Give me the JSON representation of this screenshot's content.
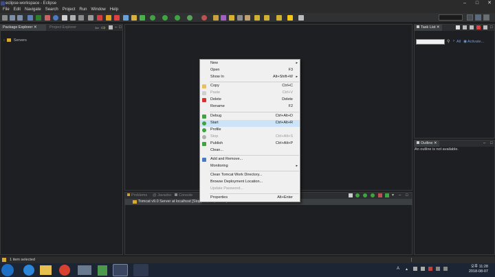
{
  "window": {
    "title": "eclipse-workspace - Eclipse"
  },
  "menubar": [
    "File",
    "Edit",
    "Navigate",
    "Search",
    "Project",
    "Run",
    "Window",
    "Help"
  ],
  "package_explorer": {
    "tabs": [
      "Package Explorer",
      "Project Explorer"
    ],
    "tree": [
      {
        "label": "Servers"
      }
    ]
  },
  "task_list": {
    "tab": "Task List",
    "filter_all": "All",
    "filter_activate": "Activate..."
  },
  "outline": {
    "tab": "Outline",
    "message": "An outline is not available."
  },
  "bottom_panel": {
    "tabs": [
      "Problems",
      "Javadoc",
      "Console"
    ],
    "server_row": "Tomcat v9.0 Server at localhost  [Stopped, Republish]"
  },
  "context_menu": {
    "items": [
      {
        "label": "New",
        "shortcut": "",
        "submenu": true,
        "disabled": false
      },
      {
        "label": "Open",
        "shortcut": "F3",
        "disabled": false
      },
      {
        "label": "Show In",
        "shortcut": "Alt+Shift+W",
        "submenu": true,
        "disabled": false
      },
      {
        "label": "Copy",
        "shortcut": "Ctrl+C",
        "disabled": false,
        "icon": "copy-icon"
      },
      {
        "label": "Paste",
        "shortcut": "Ctrl+V",
        "disabled": true,
        "icon": "paste-icon"
      },
      {
        "label": "Delete",
        "shortcut": "Delete",
        "disabled": false,
        "icon": "delete-icon"
      },
      {
        "label": "Rename",
        "shortcut": "F2",
        "disabled": false
      },
      {
        "label": "Debug",
        "shortcut": "Ctrl+Alt+D",
        "disabled": false,
        "icon": "debug-icon"
      },
      {
        "label": "Start",
        "shortcut": "Ctrl+Alt+R",
        "disabled": false,
        "highlighted": true,
        "icon": "start-icon"
      },
      {
        "label": "Profile",
        "shortcut": "",
        "disabled": false,
        "icon": "profile-icon"
      },
      {
        "label": "Stop",
        "shortcut": "Ctrl+Alt+S",
        "disabled": true,
        "icon": "stop-icon"
      },
      {
        "label": "Publish",
        "shortcut": "Ctrl+Alt+P",
        "disabled": false,
        "icon": "publish-icon"
      },
      {
        "label": "Clean...",
        "shortcut": "",
        "disabled": false
      },
      {
        "label": "Add and Remove...",
        "shortcut": "",
        "disabled": false,
        "icon": "add-remove-icon"
      },
      {
        "label": "Monitoring",
        "shortcut": "",
        "submenu": true,
        "disabled": false
      },
      {
        "label": "Clean Tomcat Work Directory...",
        "shortcut": "",
        "disabled": false
      },
      {
        "label": "Browse Deployment Location...",
        "shortcut": "",
        "disabled": false
      },
      {
        "label": "Update Password...",
        "shortcut": "",
        "disabled": true
      },
      {
        "label": "Properties",
        "shortcut": "Alt+Enter",
        "disabled": false
      }
    ]
  },
  "statusbar": {
    "text": "1 item selected"
  },
  "taskbar": {
    "tray_lang": "A",
    "clock_time": "오후 11:28",
    "clock_date": "2018-08-07"
  },
  "colors": {
    "background": "#1e1f22",
    "menu_highlight": "#cde3f7",
    "accent_green": "#3fa33f",
    "accent_yellow": "#f5c518"
  }
}
